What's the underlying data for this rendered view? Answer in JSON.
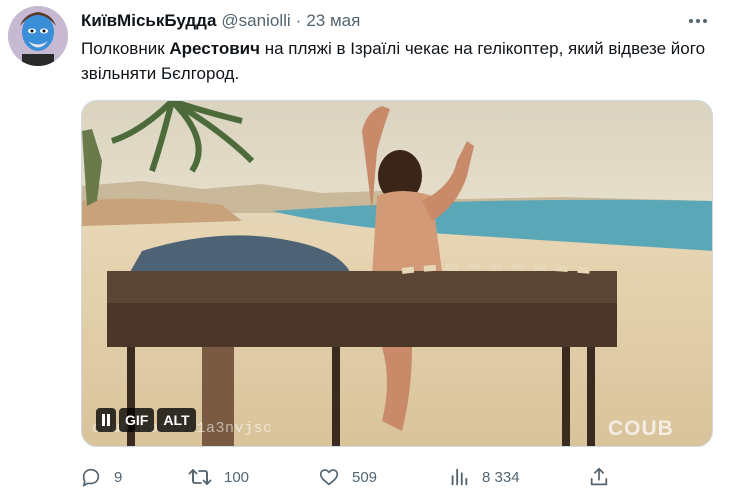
{
  "author": {
    "display_name": "КиївМіськБудда",
    "handle": "@saniolli",
    "separator": "·",
    "date": "23 мая"
  },
  "tweet": {
    "text_prefix": "Полковник ",
    "text_bold": "Арестович",
    "text_rest": " на пляжі в Ізраїлі чекає на гелікоптер, який відвезе його звільняти Бєлгород."
  },
  "media": {
    "type": "gif",
    "badge_gif": "GIF",
    "badge_alt": "ALT",
    "watermark": "coub.com/v/1a3nvjsc",
    "brand_watermark": "COUB"
  },
  "actions": {
    "replies": "9",
    "retweets": "100",
    "likes": "509",
    "views": "8 334"
  },
  "icons": [
    "avatar",
    "more-icon",
    "pause-icon",
    "reply-icon",
    "retweet-icon",
    "like-icon",
    "views-icon",
    "share-icon"
  ],
  "colors": {
    "text_primary": "#0f1419",
    "text_secondary": "#536471",
    "border": "#cfd9de"
  }
}
